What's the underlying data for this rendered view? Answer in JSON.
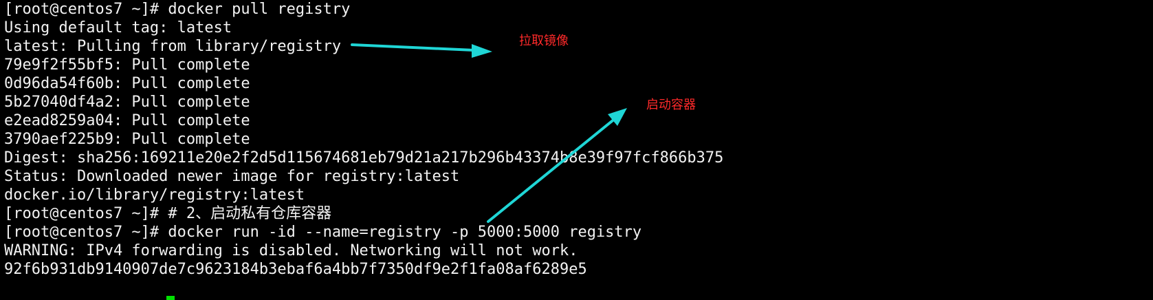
{
  "terminal": {
    "lines": [
      "[root@centos7 ~]# docker pull registry",
      "Using default tag: latest",
      "latest: Pulling from library/registry",
      "79e9f2f55bf5: Pull complete",
      "0d96da54f60b: Pull complete",
      "5b27040df4a2: Pull complete",
      "e2ead8259a04: Pull complete",
      "3790aef225b9: Pull complete",
      "Digest: sha256:169211e20e2f2d5d115674681eb79d21a217b296b43374b8e39f97fcf866b375",
      "Status: Downloaded newer image for registry:latest",
      "docker.io/library/registry:latest",
      "[root@centos7 ~]# # 2、启动私有仓库容器",
      "[root@centos7 ~]# docker run -id --name=registry -p 5000:5000 registry",
      "WARNING: IPv4 forwarding is disabled. Networking will not work.",
      "92f6b931db9140907de7c9623184b3ebaf6a4bb7f7350df9e2f1fa08af6289e5"
    ],
    "text_color": "#f2f2f2",
    "background": "#000000",
    "cursor_color": "#00e000"
  },
  "annotations": {
    "pull_image": {
      "label": "拉取镜像",
      "color": "#ff2a2a"
    },
    "start_container": {
      "label": "启动容器",
      "color": "#ff2a2a"
    },
    "arrow_color": "#1fd6d6"
  }
}
